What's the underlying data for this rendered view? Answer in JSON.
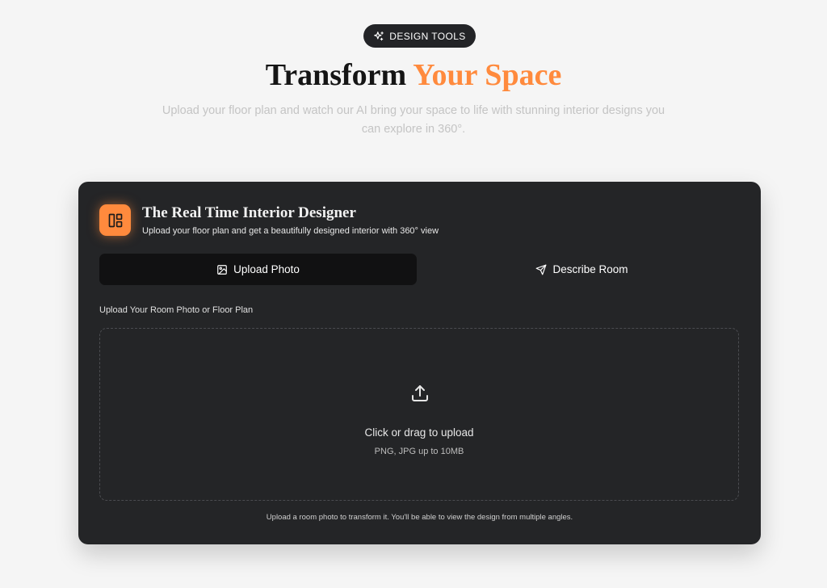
{
  "hero": {
    "badge_label": "DESIGN TOOLS",
    "title_part1": "Transform ",
    "title_part2": "Your Space",
    "subtitle": "Upload your floor plan and watch our AI bring your space to life with stunning interior designs you can explore in 360°."
  },
  "card": {
    "title": "The Real Time Interior Designer",
    "subtitle": "Upload your floor plan and get a beautifully designed interior with 360° view",
    "tabs": [
      {
        "label": "Upload Photo",
        "icon": "image-icon",
        "active": true
      },
      {
        "label": "Describe Room",
        "icon": "send-icon",
        "active": false
      }
    ],
    "section_label": "Upload Your Room Photo or Floor Plan",
    "dropzone": {
      "title": "Click or drag to upload",
      "hint": "PNG, JPG up to 10MB",
      "icon": "upload-icon"
    },
    "footnote": "Upload a room photo to transform it. You'll be able to view the design from multiple angles."
  },
  "colors": {
    "page_background": "#f5f5f5",
    "card_background": "#242527",
    "accent": "#ff8a3d",
    "active_tab": "#111112",
    "badge_background": "#232427"
  }
}
